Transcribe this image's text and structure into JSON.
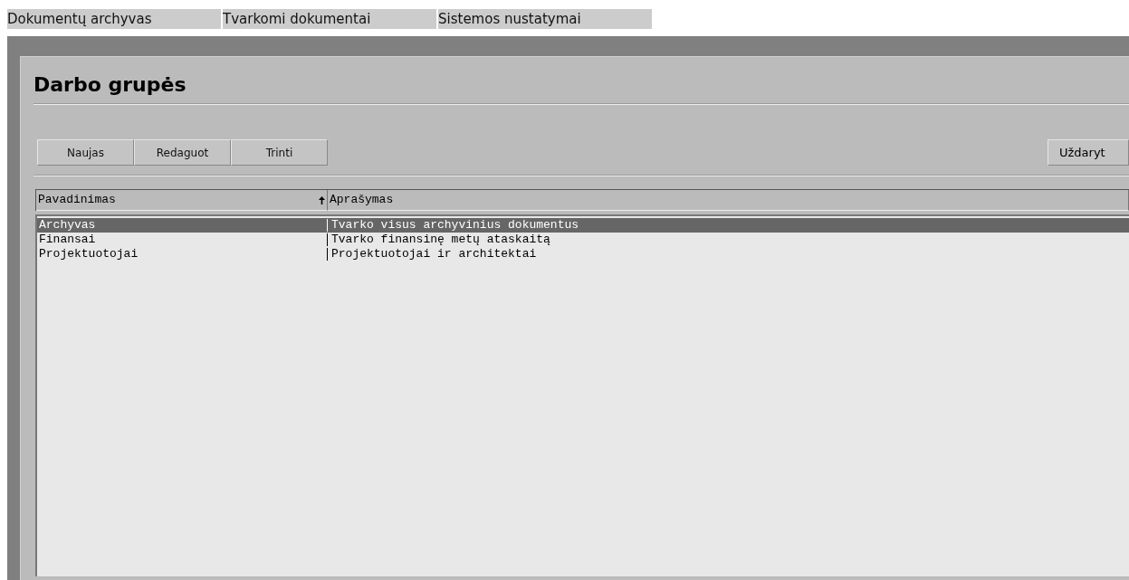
{
  "menu": [
    {
      "label": "Dokumentų archyvas",
      "selected": false
    },
    {
      "label": "Tvarkomi dokumentai",
      "selected": false
    },
    {
      "label": "Sistemos nustatymai",
      "selected": false
    }
  ],
  "title": "Darbo grupės",
  "toolbar": [
    "Naujas",
    "Redaguot",
    "Trinti"
  ],
  "close_button": "Uždaryt",
  "table": {
    "columns": [
      {
        "label": "Pavadinimas",
        "sorted": true
      },
      {
        "label": "Aprašymas",
        "sorted": false
      }
    ],
    "rows": [
      {
        "cells": [
          "Archyvas",
          "Tvarko visus archyvinius dokumentus"
        ],
        "selected": true
      },
      {
        "cells": [
          "Finansai",
          "Tvarko finansinę metų ataskaitą"
        ],
        "selected": false
      },
      {
        "cells": [
          "Projektuotojai",
          "Projektuotojai ir architektai"
        ],
        "selected": false
      }
    ]
  }
}
